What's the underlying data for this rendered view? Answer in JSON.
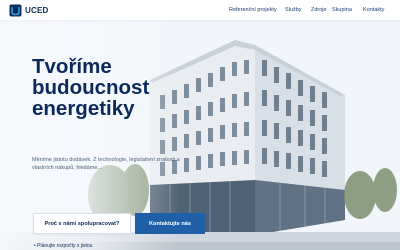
{
  "brand": {
    "name": "UCED"
  },
  "nav": {
    "items": [
      "Referenční projekty",
      "Služby",
      "Zdroje",
      "Skupina",
      "Kontakty"
    ]
  },
  "hero": {
    "headline_lines": [
      "Tvoříme",
      "budoucnost",
      "energetiky"
    ],
    "description": "Měníme jistotu dodávek. Z technologie, legislativní znalosti a vlastních nákupů, hledáme...",
    "primary_button": "Kontaktujte nás",
    "secondary_button": "Proč s námi spolupracovat?",
    "note": "• Plánujte rozpočty s jistou"
  },
  "colors": {
    "brand_navy": "#0b2a5b",
    "accent_blue": "#1f5fa8",
    "logo_cyan": "#29a6de"
  }
}
